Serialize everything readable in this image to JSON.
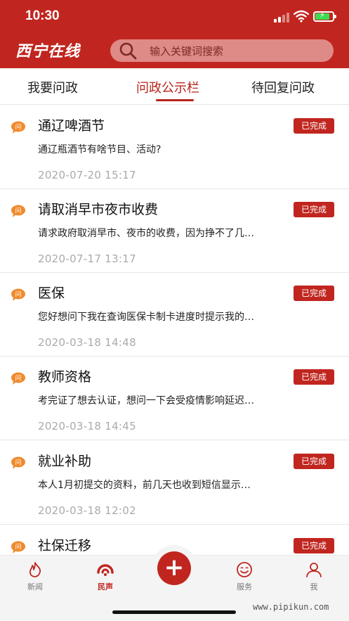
{
  "status": {
    "time": "10:30"
  },
  "header": {
    "logo_text": "西宁在线",
    "search_placeholder": "输入关键词搜索",
    "accent_color": "#c0261f"
  },
  "tabs": [
    {
      "label": "我要问政",
      "active": false
    },
    {
      "label": "问政公示栏",
      "active": true
    },
    {
      "label": "待回复问政",
      "active": false
    }
  ],
  "items": [
    {
      "icon": "question-bubble-icon",
      "icon_text": "问",
      "title": "通辽啤酒节",
      "badge": "已完成",
      "desc": "通辽瓶酒节有啥节目、活动?",
      "time": "2020-07-20  15:17"
    },
    {
      "icon": "question-bubble-icon",
      "icon_text": "问",
      "title": "请取消早市夜市收费",
      "badge": "已完成",
      "desc": "请求政府取消早市、夜市的收费，因为挣不了几…",
      "time": "2020-07-17  13:17"
    },
    {
      "icon": "question-bubble-icon",
      "icon_text": "问",
      "title": "医保",
      "badge": "已完成",
      "desc": "您好想问下我在查询医保卡制卡进度时提示我的…",
      "time": "2020-03-18  14:48"
    },
    {
      "icon": "question-bubble-icon",
      "icon_text": "问",
      "title": "教师资格",
      "badge": "已完成",
      "desc": "考完证了想去认证，想问一下会受疫情影响延迟…",
      "time": "2020-03-18  14:45"
    },
    {
      "icon": "question-bubble-icon",
      "icon_text": "问",
      "title": "就业补助",
      "badge": "已完成",
      "desc": "本人1月初提交的资料，前几天也收到短信显示…",
      "time": "2020-03-18  12:02"
    },
    {
      "icon": "question-bubble-icon",
      "icon_text": "问",
      "title": "社保迁移",
      "badge": "已完成",
      "desc": "",
      "time": ""
    }
  ],
  "tabbar": {
    "items": [
      {
        "label": "新闻",
        "icon": "news-flame-icon",
        "active": false
      },
      {
        "label": "民声",
        "icon": "voice-icon",
        "active": true
      },
      {
        "label": "服务",
        "icon": "smile-icon",
        "active": false
      },
      {
        "label": "我",
        "icon": "person-icon",
        "active": false
      }
    ],
    "add_symbol": "+"
  },
  "watermark": "www.pipikun.com"
}
